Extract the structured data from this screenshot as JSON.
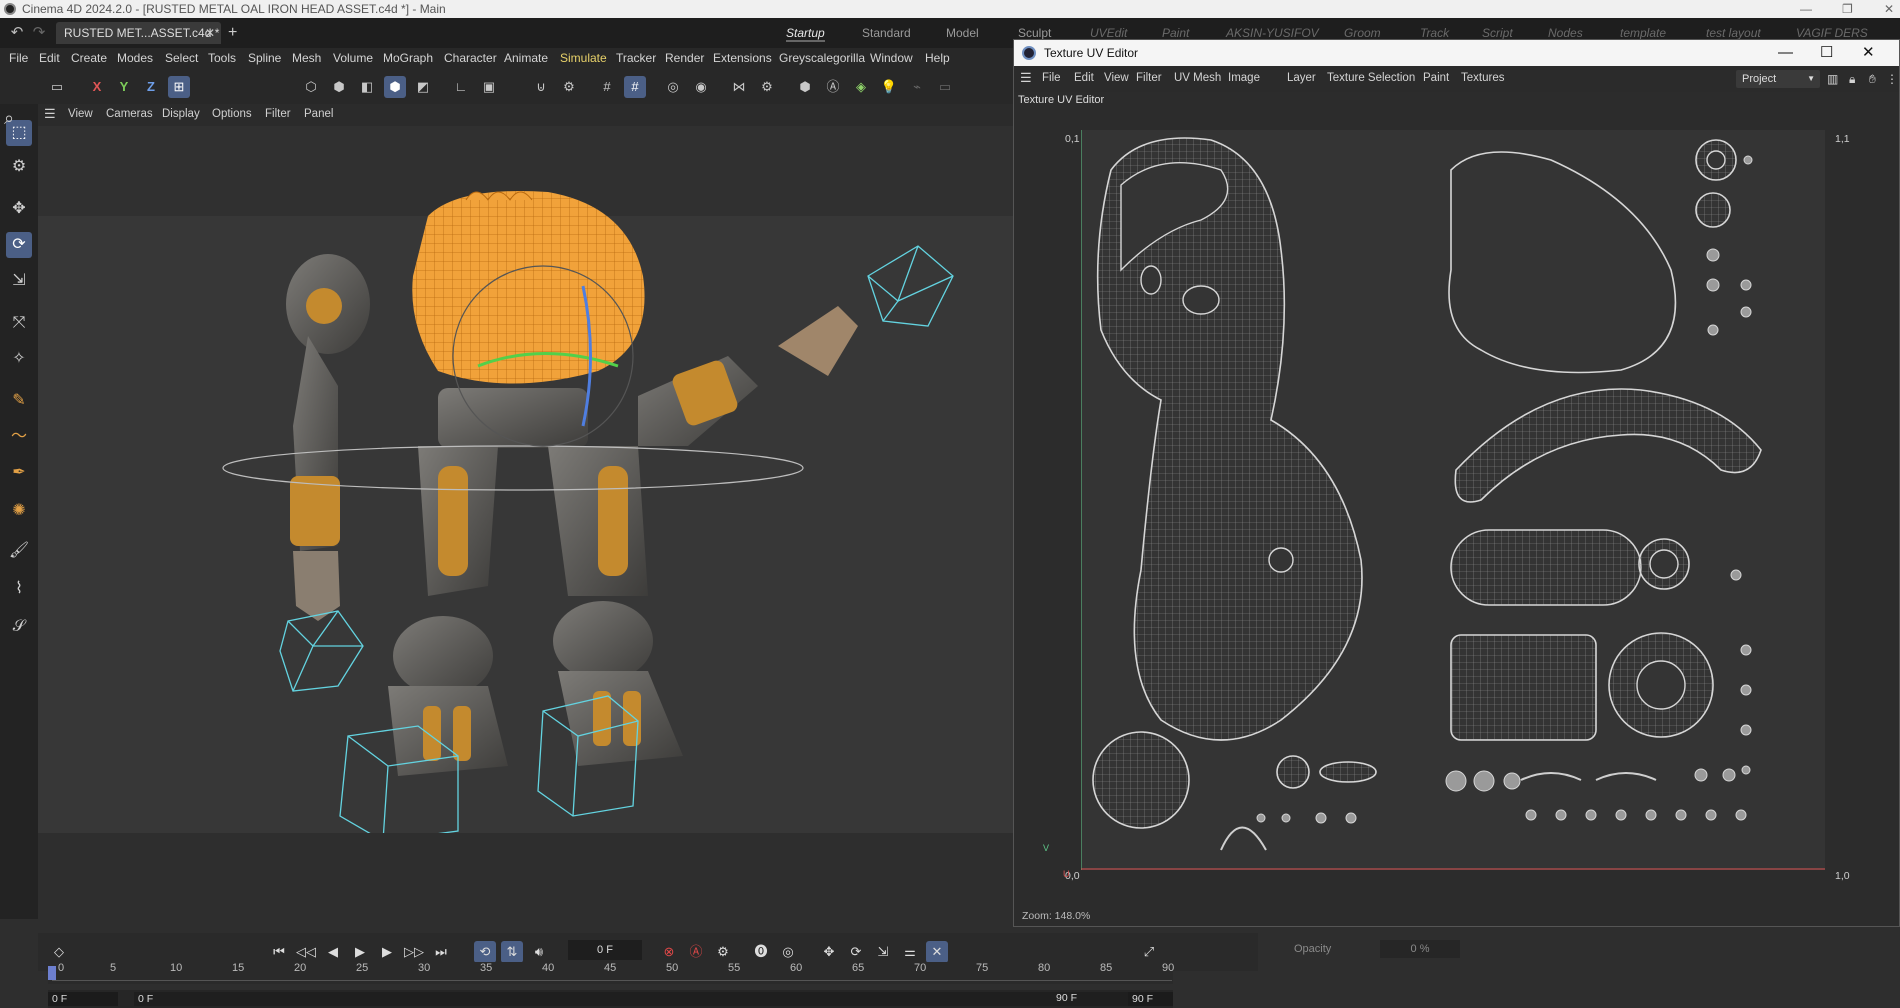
{
  "window": {
    "title": "Cinema 4D 2024.2.0 - [RUSTED METAL OAL IRON HEAD ASSET.c4d *] - Main"
  },
  "document_tab": {
    "label": "RUSTED MET...ASSET.c4d *",
    "close": "✕",
    "add": "+"
  },
  "layouts": [
    "Startup",
    "Standard",
    "Model",
    "Sculpt",
    "UVEdit",
    "Paint",
    "AKSIN-YUSIFOV",
    "Groom",
    "Track",
    "Script",
    "Nodes",
    "template",
    "test layout",
    "VAGIF DERS"
  ],
  "menu": [
    "File",
    "Edit",
    "Create",
    "Modes",
    "Select",
    "Tools",
    "Spline",
    "Mesh",
    "Volume",
    "MoGraph",
    "Character",
    "Animate",
    "Simulate",
    "Tracker",
    "Render",
    "Extensions",
    "Greyscalegorilla",
    "Window",
    "Help"
  ],
  "axis_lock": {
    "x": "X",
    "y": "Y",
    "z": "Z"
  },
  "viewport_menu": [
    "View",
    "Cameras",
    "Display",
    "Options",
    "Filter",
    "Panel"
  ],
  "uv_window": {
    "title": "Texture UV Editor",
    "menu": [
      "File",
      "Edit",
      "View",
      "Filter",
      "UV Mesh",
      "Image",
      "Layer",
      "Texture Selection",
      "Paint",
      "Textures"
    ],
    "dropdown": "Project",
    "label": "Texture UV Editor",
    "coord_tl": "0,1",
    "coord_tr": "1,1",
    "coord_bl": "0,0",
    "coord_br": "1,0",
    "axis_v": "V",
    "axis_u": "U",
    "zoom": "Zoom: 148.0%"
  },
  "timeline": {
    "current_frame": "0 F",
    "ticks": [
      "0",
      "5",
      "10",
      "15",
      "20",
      "25",
      "30",
      "35",
      "40",
      "45",
      "50",
      "55",
      "60",
      "65",
      "70",
      "75",
      "80",
      "85",
      "90"
    ],
    "range_start": "0 F",
    "range_start2": "0 F",
    "range_end": "90 F",
    "range_end2": "90 F"
  },
  "attributes": {
    "opacity_label": "Opacity",
    "opacity_value": "0 %"
  },
  "colors": {
    "accent_blue": "#4b5f86",
    "orange_selection": "#f1a23a",
    "cage_cyan": "#63d3e0",
    "uv_wire": "#bdbdbd"
  }
}
